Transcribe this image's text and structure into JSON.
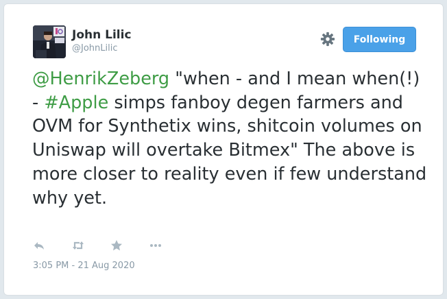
{
  "author": {
    "display_name": "John Lilic",
    "handle": "@JohnLilic"
  },
  "header": {
    "settings_icon": "gear-icon",
    "follow_label": "Following",
    "follow_color": "#4aa1e8"
  },
  "tweet": {
    "mention": "@HenrikZeberg",
    "text_part1": " \"when - and I mean when(!) - ",
    "hashtag": "#Apple",
    "text_part2": " simps fanboy degen farmers and OVM for Synthetix wins, shitcoin volumes on Uniswap will overtake Bitmex\" The above is more closer to reality even if few understand why yet.",
    "link_color": "#3e9c45"
  },
  "actions": {
    "reply": "reply-icon",
    "retweet": "retweet-icon",
    "like": "star-icon",
    "more": "more-icon"
  },
  "timestamp": "3:05 PM - 21 Aug 2020"
}
